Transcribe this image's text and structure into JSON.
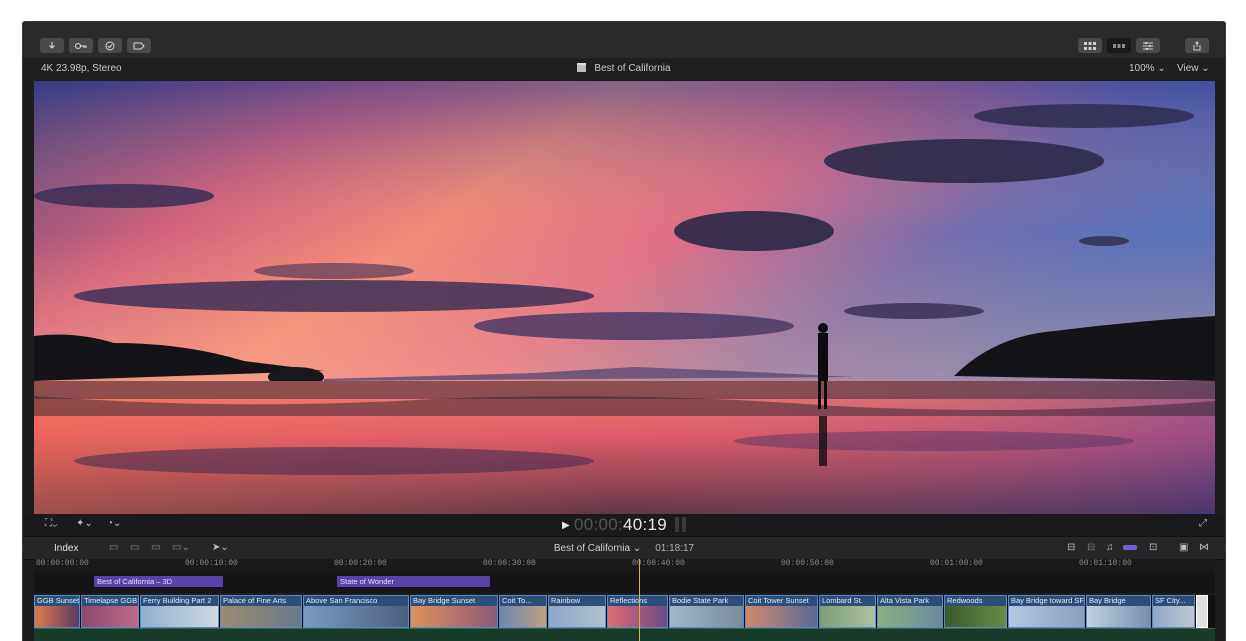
{
  "toolbar": {
    "left_icons": [
      "import-icon",
      "keyword-icon",
      "analyze-icon",
      "tag-icon"
    ],
    "right_icons": [
      "browser-grid-icon",
      "timeline-icon",
      "inspector-icon",
      "share-icon"
    ]
  },
  "info_bar": {
    "format": "4K 23.98p, Stereo",
    "project_title": "Best of California",
    "zoom": "100%",
    "view_menu": "View"
  },
  "viewer": {
    "timecode_dim": "00:00:",
    "timecode_bright": "40:19"
  },
  "timeline_header": {
    "index_label": "Index",
    "project_name": "Best of California",
    "duration": "01:18:17"
  },
  "ruler": {
    "ticks": [
      "00:00:00:00",
      "00:00:10:00",
      "00:00:20:00",
      "00:00:30:00",
      "00:00:40:00",
      "00:00:50:00",
      "00:01:00:00",
      "00:01:10:00"
    ]
  },
  "storylines": [
    "Best of California – 3D",
    "State of Wonder"
  ],
  "clips": [
    "GGB Sunset",
    "Timelapse GGB",
    "Ferry Building Part 2",
    "Palace of Fine Arts",
    "Above San Francisco",
    "Bay Bridge Sunset",
    "Coit To...",
    "Rainbow",
    "Reflections",
    "Bodie State Park",
    "Coit Tower Sunset",
    "Lombard St.",
    "Alta Vista Park",
    "Redwoods",
    "Bay Bridge toward SF",
    "Bay Bridge",
    "SF City..."
  ],
  "colors": {
    "clip_blue": "#2b4f7a",
    "storyline_purple": "#5a43a8",
    "playhead": "#d6b24a"
  }
}
